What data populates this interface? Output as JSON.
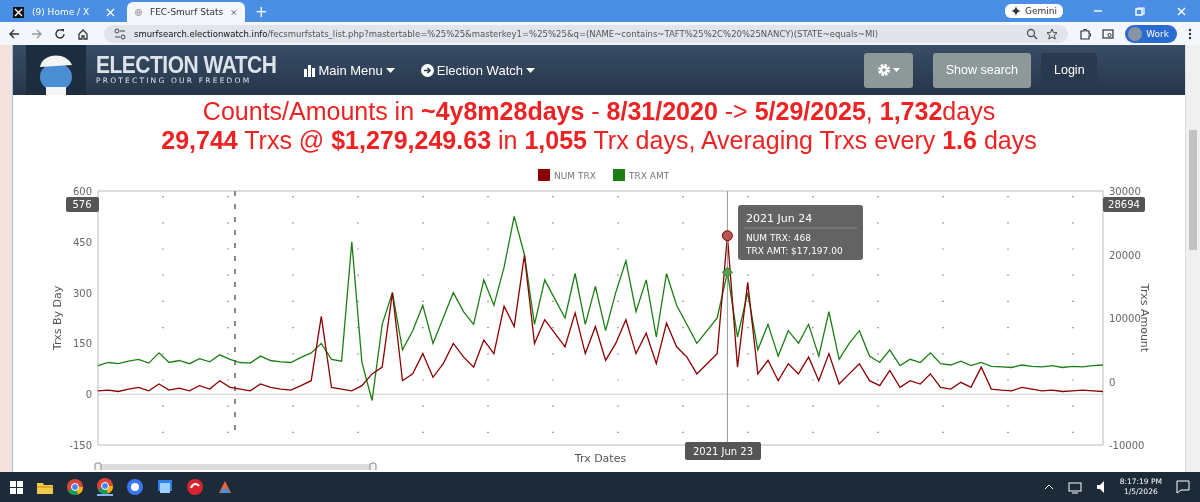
{
  "browser": {
    "tabs": [
      {
        "title": "(9) Home / X",
        "selected": false
      },
      {
        "title": "FEC-Smurf Stats",
        "selected": true
      }
    ],
    "new_tab": "+",
    "gemini": "Gemini",
    "url_host": "smurfsearch.electionwatch.info",
    "url_path": "/fecsmurfstats_list.php?mastertable=%25%25&masterkey1=%25%25&q=(NAME~contains~TAFT%25%2C%20%25NANCY)(STATE~equals~MI)",
    "profile": "Work"
  },
  "navbar": {
    "logo_title": "ELECTION WATCH",
    "logo_tagline": "PROTECTING OUR FREEDOM",
    "menus": [
      "Main Menu",
      "Election Watch"
    ],
    "buttons": [
      "Show search",
      "Login"
    ]
  },
  "headline": [
    "Counts/Amounts in **~4y8m28days** - **8/31/2020** -> **5/29/2025**, **1,732**days",
    "**29,744** Trxs @ **$1,279,249.63** in **1,055** Trx days, Averaging Trxs every **1.6** days"
  ],
  "chart": {
    "chart_data": {
      "type": "line",
      "xlabel": "Trx Dates",
      "ylabel": "Trxs By Day",
      "ylim": [
        -150,
        600
      ],
      "yticks": [
        600,
        450,
        300,
        150,
        0,
        -150
      ],
      "y2lim": [
        -10000,
        30000
      ],
      "y2ticks": [
        30000,
        20000,
        10000,
        0,
        -10000
      ],
      "y2label": "Trxs Amount",
      "grid": true,
      "legend": true,
      "series": [
        {
          "name": "NUM TRX",
          "color": "#8b0000",
          "values": [
            10,
            12,
            8,
            15,
            20,
            10,
            30,
            12,
            18,
            10,
            25,
            15,
            40,
            20,
            15,
            10,
            30,
            20,
            15,
            12,
            25,
            40,
            230,
            20,
            15,
            10,
            25,
            60,
            80,
            300,
            40,
            60,
            120,
            50,
            90,
            150,
            110,
            80,
            160,
            120,
            260,
            200,
            410,
            150,
            220,
            180,
            140,
            240,
            120,
            200,
            100,
            150,
            220,
            120,
            180,
            90,
            210,
            140,
            110,
            60,
            90,
            120,
            468,
            80,
            330,
            60,
            100,
            40,
            90,
            60,
            110,
            40,
            120,
            30,
            60,
            90,
            40,
            25,
            70,
            20,
            40,
            30,
            60,
            20,
            15,
            35,
            20,
            80,
            15,
            12,
            10,
            20,
            15,
            10,
            12,
            8,
            10,
            12,
            10,
            8
          ]
        },
        {
          "name": "TRX AMT",
          "color": "#1a7f12",
          "axis": "y2",
          "values": [
            2500,
            3000,
            2800,
            3200,
            3500,
            2900,
            4500,
            3000,
            3300,
            2800,
            3600,
            3100,
            4200,
            3500,
            3000,
            2900,
            4000,
            3300,
            3100,
            3000,
            3800,
            4500,
            6000,
            3500,
            3200,
            22000,
            3000,
            -3000,
            9000,
            14000,
            5000,
            8000,
            12000,
            6000,
            10000,
            14000,
            11000,
            9000,
            16000,
            12000,
            18000,
            26000,
            20000,
            9000,
            16000,
            13000,
            10000,
            17000,
            9000,
            15000,
            8000,
            14000,
            19000,
            11000,
            16000,
            7000,
            17000,
            12000,
            9000,
            6000,
            8000,
            10000,
            17200,
            7000,
            14000,
            5000,
            9000,
            4000,
            8000,
            6000,
            9000,
            4000,
            11000,
            3500,
            6000,
            8000,
            4000,
            3000,
            5000,
            2500,
            3500,
            3000,
            4500,
            2800,
            2600,
            3200,
            2500,
            3000,
            2400,
            2300,
            2200,
            2600,
            2400,
            2300,
            2500,
            2200,
            2400,
            2300,
            2500,
            2600
          ]
        }
      ]
    },
    "left_flag": "576",
    "right_flag": "28694",
    "tooltip": {
      "title": "2021 Jun 24",
      "lines": [
        "NUM TRX: 468",
        "TRX AMT: $17,197.00"
      ]
    },
    "crosshair_label": "2021 Jun 23"
  },
  "taskbar": {
    "time": "8:17:19 PM",
    "date": "1/5/2026"
  }
}
